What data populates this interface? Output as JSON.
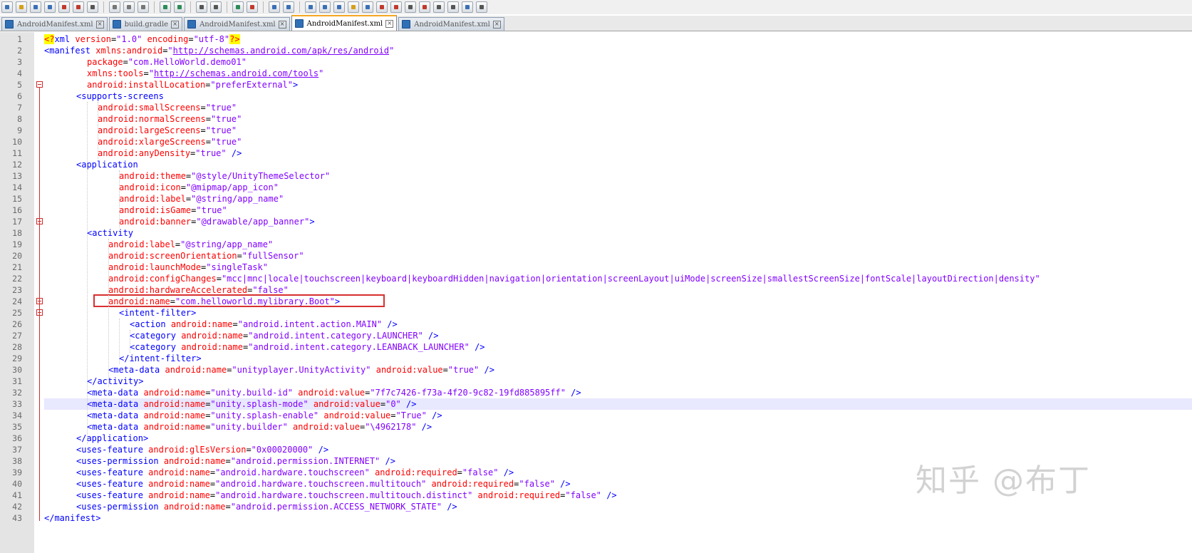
{
  "toolbar": {
    "icons": [
      "new-file-icon",
      "open-file-icon",
      "save-icon",
      "save-all-icon",
      "close-icon",
      "close-all-icon",
      "print-icon",
      "cut-icon",
      "copy-icon",
      "paste-icon",
      "undo-icon",
      "redo-icon",
      "find-icon",
      "replace-icon",
      "zoom-in-icon",
      "zoom-out-icon",
      "sync-vertical-icon",
      "sync-horizontal-icon",
      "word-wrap-icon",
      "show-all-chars-icon",
      "indent-guide-icon",
      "user-language-icon",
      "function-list-icon",
      "color-picker-icon",
      "doc-map-icon",
      "monitor-icon",
      "record-macro-icon",
      "stop-macro-icon",
      "play-macro-icon",
      "run-macro-multiple-icon",
      "save-macro-icon"
    ]
  },
  "tabs": [
    {
      "label": "AndroidManifest.xml",
      "active": false
    },
    {
      "label": "build.gradle",
      "active": false
    },
    {
      "label": "AndroidManifest.xml",
      "active": false
    },
    {
      "label": "AndroidManifest.xml",
      "active": true
    },
    {
      "label": "AndroidManifest.xml",
      "active": false
    }
  ],
  "editor": {
    "current_line": 33,
    "highlighted_line": 24,
    "lines": [
      {
        "n": "1",
        "indent": 0,
        "tokens": [
          [
            "pi",
            "<?"
          ],
          [
            "tag",
            "xml"
          ],
          [
            "at",
            " version"
          ],
          [
            "eq",
            "="
          ],
          [
            "val",
            "\"1.0\""
          ],
          [
            "at",
            " encoding"
          ],
          [
            "eq",
            "="
          ],
          [
            "val",
            "\"utf-8\""
          ],
          [
            "pi",
            "?>"
          ]
        ]
      },
      {
        "n": "2",
        "indent": 0,
        "tokens": [
          [
            "br",
            "<"
          ],
          [
            "tag",
            "manifest"
          ],
          [
            "at",
            " xmlns:android"
          ],
          [
            "eq",
            "="
          ],
          [
            "val",
            "\""
          ],
          [
            "url",
            "http://schemas.android.com/apk/res/android"
          ],
          [
            "val",
            "\""
          ]
        ]
      },
      {
        "n": "3",
        "indent": 8,
        "tokens": [
          [
            "at",
            "package"
          ],
          [
            "eq",
            "="
          ],
          [
            "val",
            "\"com.HelloWorld.demo01\""
          ]
        ]
      },
      {
        "n": "4",
        "indent": 8,
        "tokens": [
          [
            "at",
            "xmlns:tools"
          ],
          [
            "eq",
            "="
          ],
          [
            "val",
            "\""
          ],
          [
            "url",
            "http://schemas.android.com/tools"
          ],
          [
            "val",
            "\""
          ]
        ]
      },
      {
        "n": "5",
        "indent": 8,
        "tokens": [
          [
            "at",
            "android:installLocation"
          ],
          [
            "eq",
            "="
          ],
          [
            "val",
            "\"preferExternal\""
          ],
          [
            "br",
            ">"
          ]
        ]
      },
      {
        "n": "6",
        "indent": 6,
        "tokens": [
          [
            "br",
            "<"
          ],
          [
            "tag",
            "supports-screens"
          ]
        ]
      },
      {
        "n": "7",
        "indent": 10,
        "tokens": [
          [
            "at",
            "android:smallScreens"
          ],
          [
            "eq",
            "="
          ],
          [
            "val",
            "\"true\""
          ]
        ]
      },
      {
        "n": "8",
        "indent": 10,
        "tokens": [
          [
            "at",
            "android:normalScreens"
          ],
          [
            "eq",
            "="
          ],
          [
            "val",
            "\"true\""
          ]
        ]
      },
      {
        "n": "9",
        "indent": 10,
        "tokens": [
          [
            "at",
            "android:largeScreens"
          ],
          [
            "eq",
            "="
          ],
          [
            "val",
            "\"true\""
          ]
        ]
      },
      {
        "n": "10",
        "indent": 10,
        "tokens": [
          [
            "at",
            "android:xlargeScreens"
          ],
          [
            "eq",
            "="
          ],
          [
            "val",
            "\"true\""
          ]
        ]
      },
      {
        "n": "11",
        "indent": 10,
        "tokens": [
          [
            "at",
            "android:anyDensity"
          ],
          [
            "eq",
            "="
          ],
          [
            "val",
            "\"true\""
          ],
          [
            "br",
            " />"
          ]
        ]
      },
      {
        "n": "12",
        "indent": 6,
        "tokens": [
          [
            "br",
            "<"
          ],
          [
            "tag",
            "application"
          ]
        ]
      },
      {
        "n": "13",
        "indent": 14,
        "tokens": [
          [
            "at",
            "android:theme"
          ],
          [
            "eq",
            "="
          ],
          [
            "val",
            "\"@style/UnityThemeSelector\""
          ]
        ]
      },
      {
        "n": "14",
        "indent": 14,
        "tokens": [
          [
            "at",
            "android:icon"
          ],
          [
            "eq",
            "="
          ],
          [
            "val",
            "\"@mipmap/app_icon\""
          ]
        ]
      },
      {
        "n": "15",
        "indent": 14,
        "tokens": [
          [
            "at",
            "android:label"
          ],
          [
            "eq",
            "="
          ],
          [
            "val",
            "\"@string/app_name\""
          ]
        ]
      },
      {
        "n": "16",
        "indent": 14,
        "tokens": [
          [
            "at",
            "android:isGame"
          ],
          [
            "eq",
            "="
          ],
          [
            "val",
            "\"true\""
          ]
        ]
      },
      {
        "n": "17",
        "indent": 14,
        "tokens": [
          [
            "at",
            "android:banner"
          ],
          [
            "eq",
            "="
          ],
          [
            "val",
            "\"@drawable/app_banner\""
          ],
          [
            "br",
            ">"
          ]
        ]
      },
      {
        "n": "18",
        "indent": 8,
        "tokens": [
          [
            "br",
            "<"
          ],
          [
            "tag",
            "activity"
          ]
        ]
      },
      {
        "n": "19",
        "indent": 12,
        "tokens": [
          [
            "at",
            "android:label"
          ],
          [
            "eq",
            "="
          ],
          [
            "val",
            "\"@string/app_name\""
          ]
        ]
      },
      {
        "n": "20",
        "indent": 12,
        "tokens": [
          [
            "at",
            "android:screenOrientation"
          ],
          [
            "eq",
            "="
          ],
          [
            "val",
            "\"fullSensor\""
          ]
        ]
      },
      {
        "n": "21",
        "indent": 12,
        "tokens": [
          [
            "at",
            "android:launchMode"
          ],
          [
            "eq",
            "="
          ],
          [
            "val",
            "\"singleTask\""
          ]
        ]
      },
      {
        "n": "22",
        "indent": 12,
        "tokens": [
          [
            "at",
            "android:configChanges"
          ],
          [
            "eq",
            "="
          ],
          [
            "val",
            "\"mcc|mnc|locale|touchscreen|keyboard|keyboardHidden|navigation|orientation|screenLayout|uiMode|screenSize|smallestScreenSize|fontScale|layoutDirection|density\""
          ]
        ]
      },
      {
        "n": "23",
        "indent": 12,
        "tokens": [
          [
            "at",
            "android:hardwareAccelerated"
          ],
          [
            "eq",
            "="
          ],
          [
            "val",
            "\"false\""
          ]
        ]
      },
      {
        "n": "24",
        "indent": 12,
        "tokens": [
          [
            "at",
            "android:name"
          ],
          [
            "eq",
            "="
          ],
          [
            "val",
            "\"com.helloworld.mylibrary.Boot\""
          ],
          [
            "br",
            ">"
          ]
        ]
      },
      {
        "n": "25",
        "indent": 14,
        "tokens": [
          [
            "br",
            "<"
          ],
          [
            "tag",
            "intent-filter"
          ],
          [
            "br",
            ">"
          ]
        ]
      },
      {
        "n": "26",
        "indent": 16,
        "tokens": [
          [
            "br",
            "<"
          ],
          [
            "tag",
            "action"
          ],
          [
            "at",
            " android:name"
          ],
          [
            "eq",
            "="
          ],
          [
            "val",
            "\"android.intent.action.MAIN\""
          ],
          [
            "br",
            " />"
          ]
        ]
      },
      {
        "n": "27",
        "indent": 16,
        "tokens": [
          [
            "br",
            "<"
          ],
          [
            "tag",
            "category"
          ],
          [
            "at",
            " android:name"
          ],
          [
            "eq",
            "="
          ],
          [
            "val",
            "\"android.intent.category.LAUNCHER\""
          ],
          [
            "br",
            " />"
          ]
        ]
      },
      {
        "n": "28",
        "indent": 16,
        "tokens": [
          [
            "br",
            "<"
          ],
          [
            "tag",
            "category"
          ],
          [
            "at",
            " android:name"
          ],
          [
            "eq",
            "="
          ],
          [
            "val",
            "\"android.intent.category.LEANBACK_LAUNCHER\""
          ],
          [
            "br",
            " />"
          ]
        ]
      },
      {
        "n": "29",
        "indent": 14,
        "tokens": [
          [
            "br",
            "</"
          ],
          [
            "tag",
            "intent-filter"
          ],
          [
            "br",
            ">"
          ]
        ]
      },
      {
        "n": "30",
        "indent": 12,
        "tokens": [
          [
            "br",
            "<"
          ],
          [
            "tag",
            "meta-data"
          ],
          [
            "at",
            " android:name"
          ],
          [
            "eq",
            "="
          ],
          [
            "val",
            "\"unityplayer.UnityActivity\""
          ],
          [
            "at",
            " android:value"
          ],
          [
            "eq",
            "="
          ],
          [
            "val",
            "\"true\""
          ],
          [
            "br",
            " />"
          ]
        ]
      },
      {
        "n": "31",
        "indent": 8,
        "tokens": [
          [
            "br",
            "</"
          ],
          [
            "tag",
            "activity"
          ],
          [
            "br",
            ">"
          ]
        ]
      },
      {
        "n": "32",
        "indent": 8,
        "tokens": [
          [
            "br",
            "<"
          ],
          [
            "tag",
            "meta-data"
          ],
          [
            "at",
            " android:name"
          ],
          [
            "eq",
            "="
          ],
          [
            "val",
            "\"unity.build-id\""
          ],
          [
            "at",
            " android:value"
          ],
          [
            "eq",
            "="
          ],
          [
            "val",
            "\"7f7c7426-f73a-4f20-9c82-19fd885895ff\""
          ],
          [
            "br",
            " />"
          ]
        ]
      },
      {
        "n": "33",
        "indent": 8,
        "tokens": [
          [
            "br",
            "<"
          ],
          [
            "tag",
            "meta-data"
          ],
          [
            "at",
            " android:name"
          ],
          [
            "eq",
            "="
          ],
          [
            "val",
            "\"unity.splash-mode\""
          ],
          [
            "at",
            " android:value"
          ],
          [
            "eq",
            "="
          ],
          [
            "val",
            "\"0\""
          ],
          [
            "br",
            " />"
          ]
        ]
      },
      {
        "n": "34",
        "indent": 8,
        "tokens": [
          [
            "br",
            "<"
          ],
          [
            "tag",
            "meta-data"
          ],
          [
            "at",
            " android:name"
          ],
          [
            "eq",
            "="
          ],
          [
            "val",
            "\"unity.splash-enable\""
          ],
          [
            "at",
            " android:value"
          ],
          [
            "eq",
            "="
          ],
          [
            "val",
            "\"True\""
          ],
          [
            "br",
            " />"
          ]
        ]
      },
      {
        "n": "35",
        "indent": 8,
        "tokens": [
          [
            "br",
            "<"
          ],
          [
            "tag",
            "meta-data"
          ],
          [
            "at",
            " android:name"
          ],
          [
            "eq",
            "="
          ],
          [
            "val",
            "\"unity.builder\""
          ],
          [
            "at",
            " android:value"
          ],
          [
            "eq",
            "="
          ],
          [
            "val",
            "\"\\4962178\""
          ],
          [
            "br",
            " />"
          ]
        ]
      },
      {
        "n": "36",
        "indent": 6,
        "tokens": [
          [
            "br",
            "</"
          ],
          [
            "tag",
            "application"
          ],
          [
            "br",
            ">"
          ]
        ]
      },
      {
        "n": "37",
        "indent": 6,
        "tokens": [
          [
            "br",
            "<"
          ],
          [
            "tag",
            "uses-feature"
          ],
          [
            "at",
            " android:glEsVersion"
          ],
          [
            "eq",
            "="
          ],
          [
            "val",
            "\"0x00020000\""
          ],
          [
            "br",
            " />"
          ]
        ]
      },
      {
        "n": "38",
        "indent": 6,
        "tokens": [
          [
            "br",
            "<"
          ],
          [
            "tag",
            "uses-permission"
          ],
          [
            "at",
            " android:name"
          ],
          [
            "eq",
            "="
          ],
          [
            "val",
            "\"android.permission.INTERNET\""
          ],
          [
            "br",
            " />"
          ]
        ]
      },
      {
        "n": "39",
        "indent": 6,
        "tokens": [
          [
            "br",
            "<"
          ],
          [
            "tag",
            "uses-feature"
          ],
          [
            "at",
            " android:name"
          ],
          [
            "eq",
            "="
          ],
          [
            "val",
            "\"android.hardware.touchscreen\""
          ],
          [
            "at",
            " android:required"
          ],
          [
            "eq",
            "="
          ],
          [
            "val",
            "\"false\""
          ],
          [
            "br",
            " />"
          ]
        ]
      },
      {
        "n": "40",
        "indent": 6,
        "tokens": [
          [
            "br",
            "<"
          ],
          [
            "tag",
            "uses-feature"
          ],
          [
            "at",
            " android:name"
          ],
          [
            "eq",
            "="
          ],
          [
            "val",
            "\"android.hardware.touchscreen.multitouch\""
          ],
          [
            "at",
            " android:required"
          ],
          [
            "eq",
            "="
          ],
          [
            "val",
            "\"false\""
          ],
          [
            "br",
            " />"
          ]
        ]
      },
      {
        "n": "41",
        "indent": 6,
        "tokens": [
          [
            "br",
            "<"
          ],
          [
            "tag",
            "uses-feature"
          ],
          [
            "at",
            " android:name"
          ],
          [
            "eq",
            "="
          ],
          [
            "val",
            "\"android.hardware.touchscreen.multitouch.distinct\""
          ],
          [
            "at",
            " android:required"
          ],
          [
            "eq",
            "="
          ],
          [
            "val",
            "\"false\""
          ],
          [
            "br",
            " />"
          ]
        ]
      },
      {
        "n": "42",
        "indent": 6,
        "tokens": [
          [
            "br",
            "<"
          ],
          [
            "tag",
            "uses-permission"
          ],
          [
            "at",
            " android:name"
          ],
          [
            "eq",
            "="
          ],
          [
            "val",
            "\"android.permission.ACCESS_NETWORK_STATE\""
          ],
          [
            "br",
            " />"
          ]
        ]
      },
      {
        "n": "43",
        "indent": 0,
        "tokens": [
          [
            "br",
            "</"
          ],
          [
            "tag",
            "manifest"
          ],
          [
            "br",
            ">"
          ]
        ]
      }
    ]
  },
  "watermark": "知乎 @布丁"
}
